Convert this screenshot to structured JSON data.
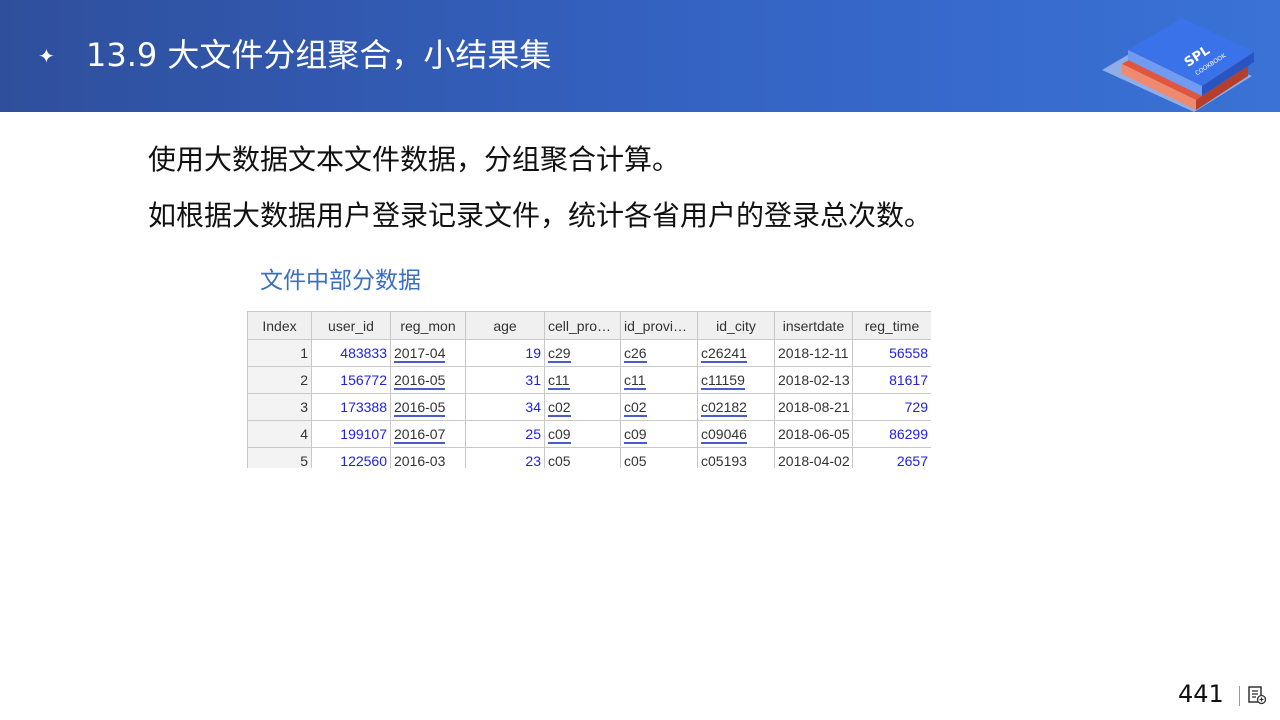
{
  "header": {
    "bullet_icon": "sparkle-icon",
    "title": "13.9 大文件分组聚合，小结果集",
    "logo": {
      "text_main": "SPL",
      "text_sub": "COOKBOOK",
      "colors": [
        "#3a72ea",
        "#e0553f"
      ]
    }
  },
  "body": {
    "line1": "使用大数据文本文件数据，分组聚合计算。",
    "line2": "如根据大数据用户登录记录文件，统计各省用户的登录总次数。"
  },
  "table": {
    "caption": "文件中部分数据",
    "headers": [
      "Index",
      "user_id",
      "reg_mon",
      "age",
      "cell_provin...",
      "id_province",
      "id_city",
      "insertdate",
      "reg_time"
    ],
    "rows": [
      [
        "1",
        "483833",
        "2017-04",
        "19",
        "c29",
        "c26",
        "c26241",
        "2018-12-11",
        "56558"
      ],
      [
        "2",
        "156772",
        "2016-05",
        "31",
        "c11",
        "c11",
        "c11159",
        "2018-02-13",
        "81617"
      ],
      [
        "3",
        "173388",
        "2016-05",
        "34",
        "c02",
        "c02",
        "c02182",
        "2018-08-21",
        "729"
      ],
      [
        "4",
        "199107",
        "2016-07",
        "25",
        "c09",
        "c09",
        "c09046",
        "2018-06-05",
        "86299"
      ],
      [
        "5",
        "122560",
        "2016-03",
        "23",
        "c05",
        "c05",
        "c05193",
        "2018-04-02",
        "2657"
      ]
    ]
  },
  "footer": {
    "page_number": "441",
    "icon": "notes-icon"
  }
}
